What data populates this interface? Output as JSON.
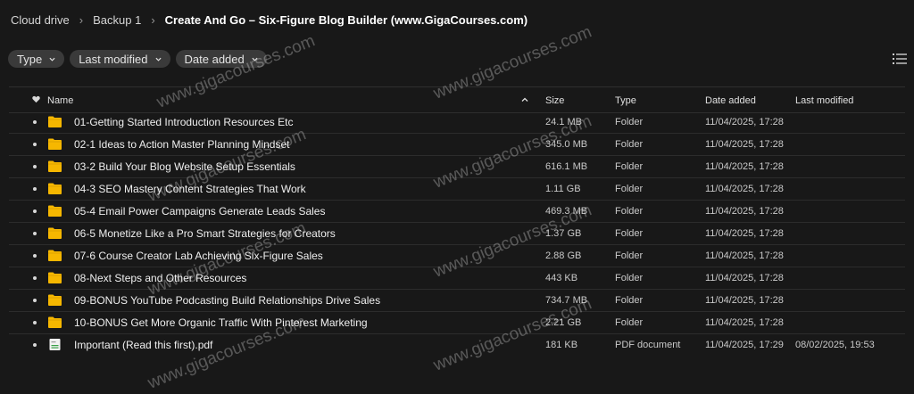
{
  "breadcrumb": {
    "root": "Cloud drive",
    "parent": "Backup 1",
    "current": "Create And Go – Six-Figure Blog Builder (www.GigaCourses.com)"
  },
  "filters": {
    "type": "Type",
    "last_modified": "Last modified",
    "date_added": "Date added"
  },
  "columns": {
    "name": "Name",
    "size": "Size",
    "type": "Type",
    "date_added": "Date added",
    "last_modified": "Last modified"
  },
  "rows": [
    {
      "name": "01-Getting Started Introduction Resources Etc",
      "size": "24.1 MB",
      "type": "Folder",
      "date_added": "11/04/2025, 17:28",
      "last_modified": "",
      "icon": "folder-icon"
    },
    {
      "name": "02-1 Ideas to Action Master Planning Mindset",
      "size": "345.0 MB",
      "type": "Folder",
      "date_added": "11/04/2025, 17:28",
      "last_modified": "",
      "icon": "folder-icon"
    },
    {
      "name": "03-2 Build Your Blog Website Setup Essentials",
      "size": "616.1 MB",
      "type": "Folder",
      "date_added": "11/04/2025, 17:28",
      "last_modified": "",
      "icon": "folder-icon"
    },
    {
      "name": "04-3 SEO Mastery Content Strategies That Work",
      "size": "1.11 GB",
      "type": "Folder",
      "date_added": "11/04/2025, 17:28",
      "last_modified": "",
      "icon": "folder-icon"
    },
    {
      "name": "05-4 Email Power Campaigns Generate Leads Sales",
      "size": "469.3 MB",
      "type": "Folder",
      "date_added": "11/04/2025, 17:28",
      "last_modified": "",
      "icon": "folder-icon"
    },
    {
      "name": "06-5 Monetize Like a Pro Smart Strategies for Creators",
      "size": "1.37 GB",
      "type": "Folder",
      "date_added": "11/04/2025, 17:28",
      "last_modified": "",
      "icon": "folder-icon"
    },
    {
      "name": "07-6 Course Creator Lab Achieving Six-Figure Sales",
      "size": "2.88 GB",
      "type": "Folder",
      "date_added": "11/04/2025, 17:28",
      "last_modified": "",
      "icon": "folder-icon"
    },
    {
      "name": "08-Next Steps and Other Resources",
      "size": "443 KB",
      "type": "Folder",
      "date_added": "11/04/2025, 17:28",
      "last_modified": "",
      "icon": "folder-icon"
    },
    {
      "name": "09-BONUS YouTube Podcasting Build Relationships Drive Sales",
      "size": "734.7 MB",
      "type": "Folder",
      "date_added": "11/04/2025, 17:28",
      "last_modified": "",
      "icon": "folder-icon"
    },
    {
      "name": "10-BONUS Get More Organic Traffic With Pinterest Marketing",
      "size": "2.21 GB",
      "type": "Folder",
      "date_added": "11/04/2025, 17:28",
      "last_modified": "",
      "icon": "folder-icon"
    },
    {
      "name": "Important (Read this first).pdf",
      "size": "181 KB",
      "type": "PDF document",
      "date_added": "11/04/2025, 17:29",
      "last_modified": "08/02/2025, 19:53",
      "icon": "pdf-file-icon"
    }
  ],
  "watermark": "www.gigacourses.com",
  "colors": {
    "background": "#181818",
    "folder": "#f6b700",
    "chip": "#3a3a3a"
  }
}
